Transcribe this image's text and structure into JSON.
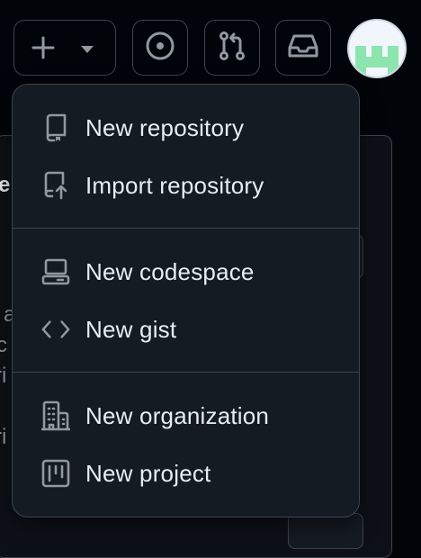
{
  "header": {
    "create": {
      "icon": "plus-icon",
      "caret": "triangle-down-icon"
    },
    "issues": {
      "icon": "issue-opened-icon"
    },
    "pulls": {
      "icon": "git-pull-request-icon"
    },
    "inbox": {
      "icon": "inbox-icon"
    },
    "avatar": {
      "icon": "identicon-avatar",
      "color": "#8ee4af"
    }
  },
  "background": {
    "fragments": [
      "e",
      "a",
      "c",
      "ri",
      "ri"
    ]
  },
  "menu": {
    "groups": [
      {
        "items": [
          {
            "label": "New repository",
            "icon": "repo-icon"
          },
          {
            "label": "Import repository",
            "icon": "repo-push-icon"
          }
        ]
      },
      {
        "items": [
          {
            "label": "New codespace",
            "icon": "codespaces-icon"
          },
          {
            "label": "New gist",
            "icon": "code-icon"
          }
        ]
      },
      {
        "items": [
          {
            "label": "New organization",
            "icon": "organization-icon"
          },
          {
            "label": "New project",
            "icon": "project-icon"
          }
        ]
      }
    ]
  },
  "colors": {
    "page_bg": "#010409",
    "menu_bg": "#151b23",
    "border": "#3d444d",
    "text": "#e6edf3",
    "icon": "#9198a1"
  }
}
